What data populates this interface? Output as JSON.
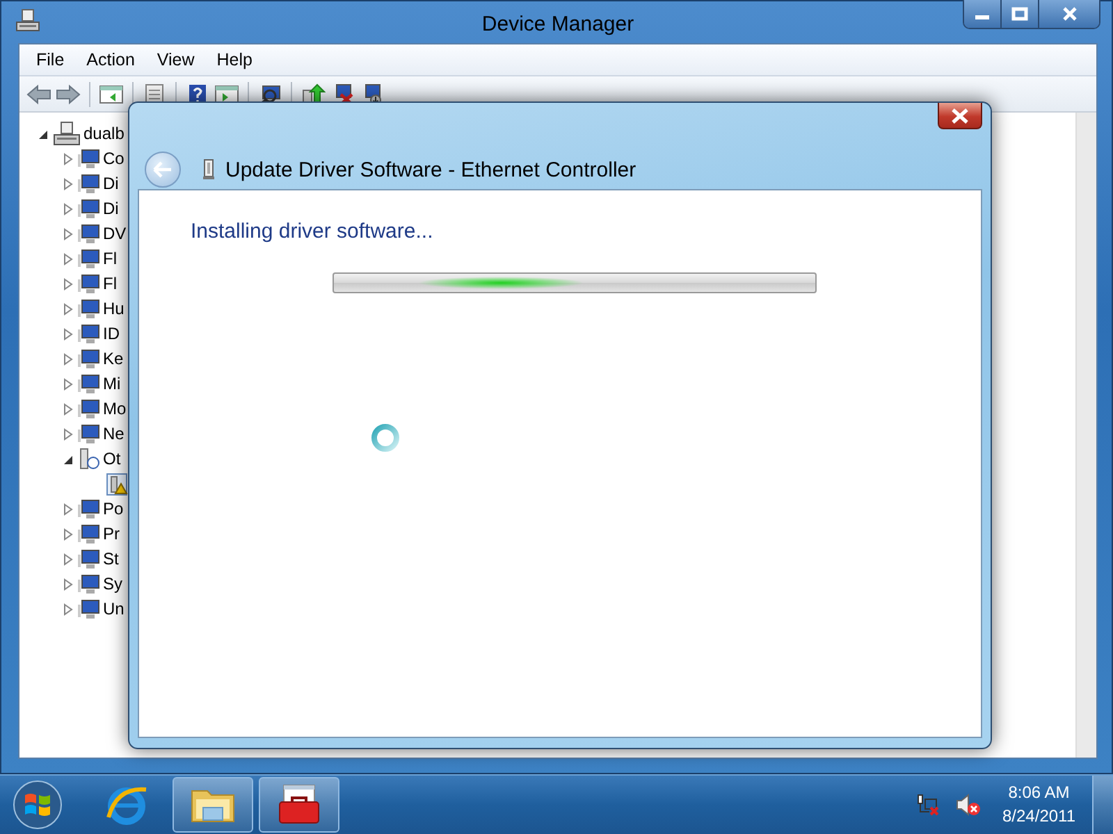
{
  "window": {
    "title": "Device Manager"
  },
  "menu": [
    "File",
    "Action",
    "View",
    "Help"
  ],
  "tree": {
    "label": "dualb",
    "expanded": true,
    "children": [
      {
        "label": "Co",
        "expanded": false
      },
      {
        "label": "Di",
        "expanded": false
      },
      {
        "label": "Di",
        "expanded": false
      },
      {
        "label": "DV",
        "expanded": false
      },
      {
        "label": "Fl",
        "expanded": false
      },
      {
        "label": "Fl",
        "expanded": false
      },
      {
        "label": "Hu",
        "expanded": false
      },
      {
        "label": "ID",
        "expanded": false
      },
      {
        "label": "Ke",
        "expanded": false
      },
      {
        "label": "Mi",
        "expanded": false
      },
      {
        "label": "Mo",
        "expanded": false
      },
      {
        "label": "Ne",
        "expanded": false
      },
      {
        "label": "Ot",
        "expanded": true,
        "children": [
          {
            "kind": "warning"
          }
        ]
      },
      {
        "label": "Po",
        "expanded": false
      },
      {
        "label": "Pr",
        "expanded": false
      },
      {
        "label": "St",
        "expanded": false
      },
      {
        "label": "Sy",
        "expanded": false
      },
      {
        "label": "Un",
        "expanded": false
      }
    ]
  },
  "dialog": {
    "title": "Update Driver Software - Ethernet Controller",
    "status": "Installing driver software...",
    "progress": {
      "indeterminate": true
    }
  },
  "taskbar": {
    "items": [
      {
        "kind": "browser",
        "running": false
      },
      {
        "kind": "folder",
        "running": true
      },
      {
        "kind": "toolbox",
        "running": true
      }
    ],
    "clock": {
      "time": "8:06 AM",
      "date": "8/24/2011"
    }
  }
}
